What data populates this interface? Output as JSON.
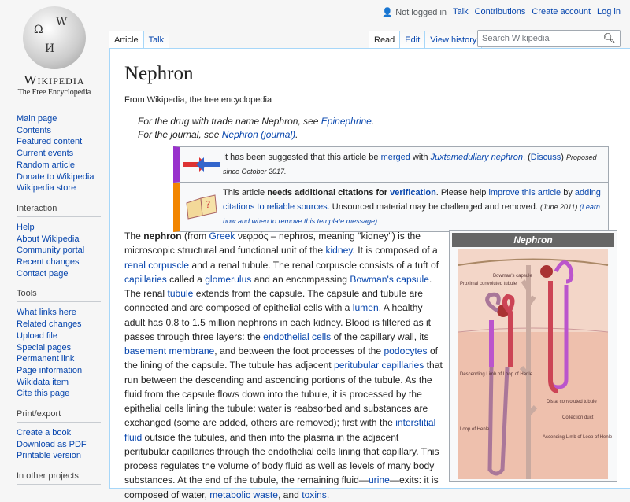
{
  "logo": {
    "wordmark": "Wikipedia",
    "tagline": "The Free Encyclopedia"
  },
  "personal": {
    "not_logged_in": "Not logged in",
    "links": [
      "Talk",
      "Contributions",
      "Create account",
      "Log in"
    ]
  },
  "tabs_left": [
    "Article",
    "Talk"
  ],
  "tabs_right": [
    "Read",
    "Edit",
    "View history"
  ],
  "search": {
    "placeholder": "Search Wikipedia"
  },
  "sidebar": {
    "nav": [
      "Main page",
      "Contents",
      "Featured content",
      "Current events",
      "Random article",
      "Donate to Wikipedia",
      "Wikipedia store"
    ],
    "interaction": {
      "heading": "Interaction",
      "items": [
        "Help",
        "About Wikipedia",
        "Community portal",
        "Recent changes",
        "Contact page"
      ]
    },
    "tools": {
      "heading": "Tools",
      "items": [
        "What links here",
        "Related changes",
        "Upload file",
        "Special pages",
        "Permanent link",
        "Page information",
        "Wikidata item",
        "Cite this page"
      ]
    },
    "print": {
      "heading": "Print/export",
      "items": [
        "Create a book",
        "Download as PDF",
        "Printable version"
      ]
    },
    "other": {
      "heading": "In other projects"
    }
  },
  "title": "Nephron",
  "subtitle": "From Wikipedia, the free encyclopedia",
  "hatnotes": [
    [
      {
        "t": "For the drug with trade name Nephron, see "
      },
      {
        "t": "Epinephrine",
        "l": 1
      },
      {
        "t": "."
      }
    ],
    [
      {
        "t": "For the journal, see "
      },
      {
        "t": "Nephron (journal)",
        "l": 1
      },
      {
        "t": "."
      }
    ]
  ],
  "merge_box": [
    {
      "t": "It has been suggested that this article be "
    },
    {
      "t": "merged",
      "l": 1
    },
    {
      "t": " with "
    },
    {
      "t": "Juxtamedullary nephron",
      "l": 1,
      "i": 1
    },
    {
      "t": ". ("
    },
    {
      "t": "Discuss",
      "l": 1
    },
    {
      "t": ") "
    },
    {
      "t": "Proposed since October 2017.",
      "s": 1
    }
  ],
  "citation_box": [
    {
      "t": "This article "
    },
    {
      "t": "needs additional citations for ",
      "b": 1
    },
    {
      "t": "verification",
      "l": 1,
      "b": 1
    },
    {
      "t": ". Please help "
    },
    {
      "t": "improve this article",
      "l": 1
    },
    {
      "t": " by "
    },
    {
      "t": "adding citations to reliable sources",
      "l": 1
    },
    {
      "t": ". Unsourced material may be challenged and removed. "
    },
    {
      "t": "(June 2011) ",
      "s": 1
    },
    {
      "t": "(Learn how and when to remove this template message)",
      "s": 1,
      "l": 1
    }
  ],
  "paragraph": [
    {
      "t": "The "
    },
    {
      "t": "nephron",
      "b": 1
    },
    {
      "t": " (from "
    },
    {
      "t": "Greek",
      "l": 1
    },
    {
      "t": " νεφρός – nephros, meaning \"kidney\") is the microscopic structural and functional unit of the "
    },
    {
      "t": "kidney",
      "l": 1
    },
    {
      "t": ". It is composed of a "
    },
    {
      "t": "renal corpuscle",
      "l": 1
    },
    {
      "t": " and a renal tubule. The renal corpuscle consists of a tuft of "
    },
    {
      "t": "capillaries",
      "l": 1
    },
    {
      "t": " called a "
    },
    {
      "t": "glomerulus",
      "l": 1
    },
    {
      "t": " and an encompassing "
    },
    {
      "t": "Bowman's capsule",
      "l": 1
    },
    {
      "t": ". The renal "
    },
    {
      "t": "tubule",
      "l": 1
    },
    {
      "t": " extends from the capsule. The capsule and tubule are connected and are composed of epithelial cells with a "
    },
    {
      "t": "lumen",
      "l": 1
    },
    {
      "t": ". A healthy adult has 0.8 to 1.5 million nephrons in each kidney. Blood is filtered as it passes through three layers: the "
    },
    {
      "t": "endothelial cells",
      "l": 1
    },
    {
      "t": " of the capillary wall, its "
    },
    {
      "t": "basement membrane",
      "l": 1
    },
    {
      "t": ", and between the foot processes of the "
    },
    {
      "t": "podocytes",
      "l": 1
    },
    {
      "t": " of the lining of the capsule. The tubule has adjacent "
    },
    {
      "t": "peritubular capillaries",
      "l": 1
    },
    {
      "t": " that run between the descending and ascending portions of the tubule. As the fluid from the capsule flows down into the tubule, it is processed by the epithelial cells lining the tubule: water is reabsorbed and substances are exchanged (some are added, others are removed); first with the "
    },
    {
      "t": "interstitial fluid",
      "l": 1
    },
    {
      "t": " outside the tubules, and then into the plasma in the adjacent peritubular capillaries through the endothelial cells lining that capillary. This process regulates the volume of body fluid as well as levels of many body substances. At the end of the tubule, the remaining fluid—"
    },
    {
      "t": "urine",
      "l": 1
    },
    {
      "t": "—exits: it is composed of water, "
    },
    {
      "t": "metabolic waste",
      "l": 1
    },
    {
      "t": ", and "
    },
    {
      "t": "toxins",
      "l": 1
    },
    {
      "t": "."
    }
  ],
  "infobox": {
    "caption": "Nephron",
    "labels": [
      "Proximal convoluted tubule",
      "Bowman's capsule",
      "Descending Limb of Loop of Henle",
      "Loop of Henle",
      "Distal convoluted tubule",
      "Collection duct",
      "Ascending Limb of Loop of Henle"
    ]
  }
}
